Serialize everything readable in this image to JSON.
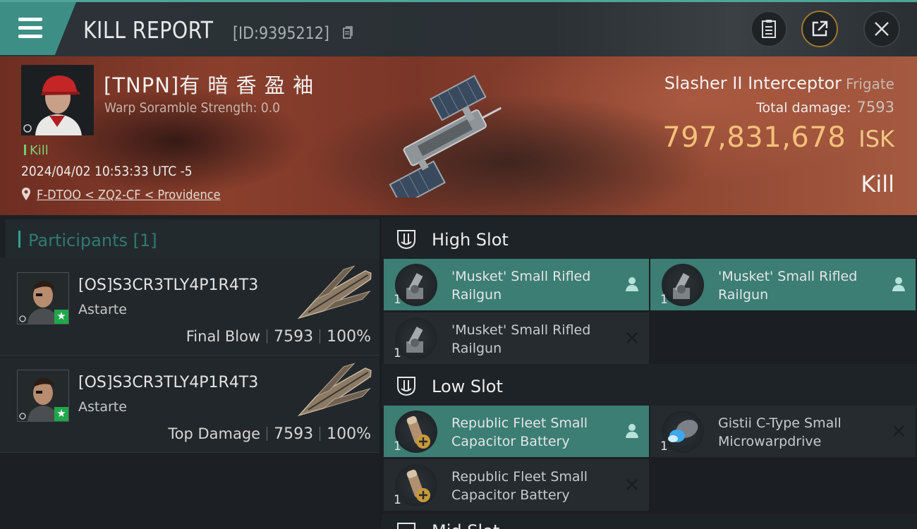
{
  "header": {
    "title": "KILL REPORT",
    "report_id": "[ID:9395212]"
  },
  "victim": {
    "name": "[TNPN]有 暗 香 盈 袖",
    "warp_scramble": "Warp Soramble Strength: 0.0",
    "status": "Kill",
    "datetime": "2024/04/02 10:53:33 UTC -5",
    "location": "F-DTOO < ZQ2-CF < Providence",
    "ship_name": "Slasher II Interceptor",
    "ship_class": "Frigate",
    "total_damage_label": "Total damage:",
    "total_damage": "7593",
    "isk_value": "797,831,678",
    "isk_unit": "ISK",
    "result": "Kill"
  },
  "participants": {
    "label": "Participants",
    "count": "[1]",
    "rows": [
      {
        "name": "[OS]S3CR3TLY4P1R4T3",
        "ship": "Astarte",
        "role": "Final Blow",
        "damage": "7593",
        "percent": "100%"
      },
      {
        "name": "[OS]S3CR3TLY4P1R4T3",
        "ship": "Astarte",
        "role": "Top Damage",
        "damage": "7593",
        "percent": "100%"
      }
    ]
  },
  "fitting": {
    "high_slot_label": "High Slot",
    "low_slot_label": "Low Slot",
    "mid_slot_label": "Mid Slot",
    "high_items": [
      {
        "qty": "1",
        "name": "'Musket' Small Rifled Railgun",
        "status": "dropped"
      },
      {
        "qty": "1",
        "name": "'Musket' Small Rifled Railgun",
        "status": "dropped"
      },
      {
        "qty": "1",
        "name": "'Musket' Small Rifled Railgun",
        "status": "destroyed"
      }
    ],
    "low_items": [
      {
        "qty": "1",
        "name": "Republic Fleet Small Capacitor Battery",
        "status": "dropped"
      },
      {
        "qty": "1",
        "name": "Gistii C-Type Small Microwarpdrive",
        "status": "destroyed"
      },
      {
        "qty": "1",
        "name": "Republic Fleet Small Capacitor Battery",
        "status": "destroyed"
      }
    ]
  },
  "colors": {
    "accent": "#3c7d74",
    "isk": "#f4c07a",
    "kill_green": "#7fd07a"
  }
}
